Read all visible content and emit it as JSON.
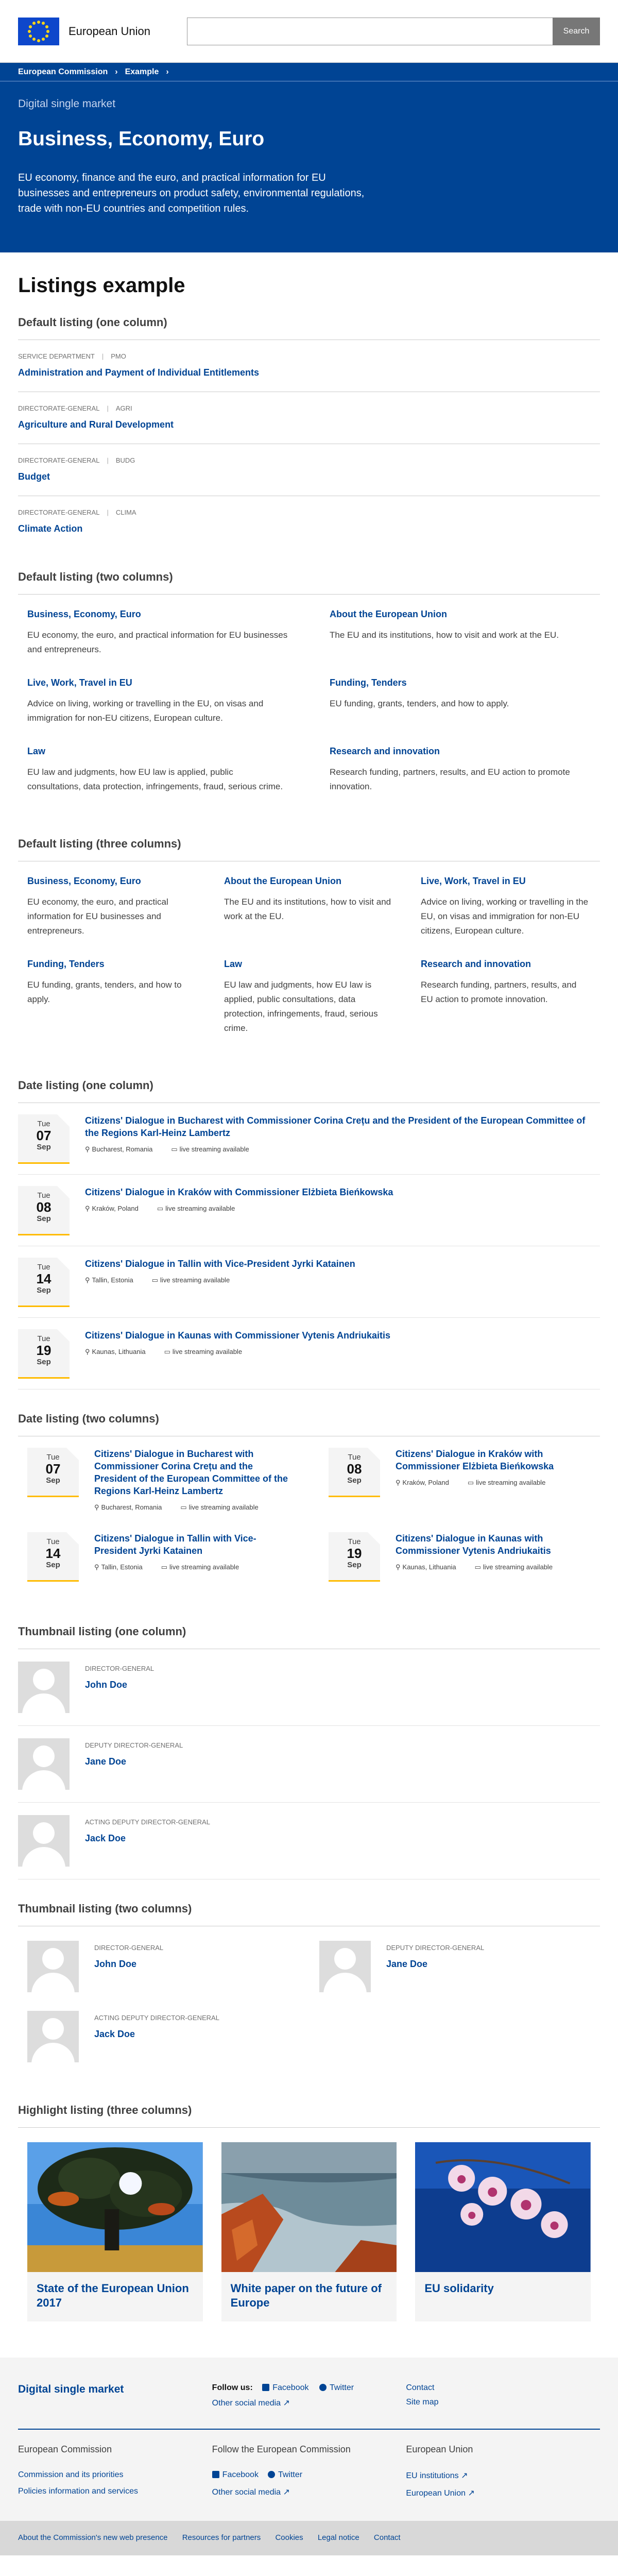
{
  "header": {
    "logo_text": "European Union",
    "search_placeholder": "",
    "search_button": "Search"
  },
  "breadcrumb": [
    "European Commission",
    "Example"
  ],
  "banner": {
    "site": "Digital single market",
    "title": "Business, Economy, Euro",
    "description": "EU economy, finance and the euro, and practical information for EU businesses and entrepreneurs on product safety, environmental regulations, trade with non-EU countries and competition rules."
  },
  "page_title": "Listings example",
  "list1": {
    "heading": "Default listing (one column)",
    "items": [
      {
        "meta1": "SERVICE DEPARTMENT",
        "meta2": "PMO",
        "title": "Administration and Payment of Individual Entitlements"
      },
      {
        "meta1": "DIRECTORATE-GENERAL",
        "meta2": "AGRI",
        "title": "Agriculture and Rural Development"
      },
      {
        "meta1": "DIRECTORATE-GENERAL",
        "meta2": "BUDG",
        "title": "Budget"
      },
      {
        "meta1": "DIRECTORATE-GENERAL",
        "meta2": "CLIMA",
        "title": "Climate Action"
      }
    ]
  },
  "list2": {
    "heading": "Default listing (two columns)",
    "items": [
      {
        "title": "Business, Economy, Euro",
        "text": "EU economy, the euro, and practical information for EU businesses and entrepreneurs."
      },
      {
        "title": "About the European Union",
        "text": "The EU and its institutions, how to visit and work at the EU."
      },
      {
        "title": "Live, Work, Travel in EU",
        "text": "Advice on living, working or travelling in the EU, on visas and immigration for non-EU citizens, European culture."
      },
      {
        "title": "Funding, Tenders",
        "text": "EU funding, grants, tenders, and how to apply."
      },
      {
        "title": "Law",
        "text": "EU law and judgments, how EU law is applied, public consultations, data protection, infringements, fraud, serious crime."
      },
      {
        "title": "Research and innovation",
        "text": "Research funding, partners, results, and EU action to promote innovation."
      }
    ]
  },
  "list3": {
    "heading": "Default listing (three columns)",
    "items": [
      {
        "title": "Business, Economy, Euro",
        "text": "EU economy, the euro, and practical information for EU businesses and entrepreneurs."
      },
      {
        "title": "About the European Union",
        "text": "The EU and its institutions, how to visit and work at the EU."
      },
      {
        "title": "Live, Work, Travel in EU",
        "text": "Advice on living, working or travelling in the EU, on visas and immigration for non-EU citizens, European culture."
      },
      {
        "title": "Funding, Tenders",
        "text": "EU funding, grants, tenders, and how to apply."
      },
      {
        "title": "Law",
        "text": "EU law and judgments, how EU law is applied, public consultations, data protection, infringements, fraud, serious crime."
      },
      {
        "title": "Research and innovation",
        "text": "Research funding, partners, results, and EU action to promote innovation."
      }
    ]
  },
  "dates1": {
    "heading": "Date listing (one column)"
  },
  "dates2": {
    "heading": "Date listing (two columns)"
  },
  "events": [
    {
      "day": "Tue",
      "date": "07",
      "month": "Sep",
      "title": "Citizens' Dialogue in Bucharest with Commissioner Corina Crețu and the President of the European Committee of the Regions Karl-Heinz Lambertz",
      "place": "Bucharest, Romania",
      "stream": "live streaming available"
    },
    {
      "day": "Tue",
      "date": "08",
      "month": "Sep",
      "title": "Citizens' Dialogue in Kraków with Commissioner Elżbieta Bieńkowska",
      "place": "Kraków, Poland",
      "stream": "live streaming available"
    },
    {
      "day": "Tue",
      "date": "14",
      "month": "Sep",
      "title": "Citizens' Dialogue in Tallin with Vice-President Jyrki Katainen",
      "place": "Tallin, Estonia",
      "stream": "live streaming available"
    },
    {
      "day": "Tue",
      "date": "19",
      "month": "Sep",
      "title": "Citizens' Dialogue in Kaunas with Commissioner Vytenis Andriukaitis",
      "place": "Kaunas, Lithuania",
      "stream": "live streaming available"
    }
  ],
  "thumbs1": {
    "heading": "Thumbnail listing (one column)"
  },
  "thumbs2": {
    "heading": "Thumbnail listing (two columns)"
  },
  "people": [
    {
      "role": "DIRECTOR-GENERAL",
      "name": "John Doe"
    },
    {
      "role": "DEPUTY DIRECTOR-GENERAL",
      "name": "Jane Doe"
    },
    {
      "role": "ACTING DEPUTY DIRECTOR-GENERAL",
      "name": "Jack Doe"
    }
  ],
  "highlight": {
    "heading": "Highlight listing (three columns)",
    "items": [
      {
        "title": "State of the European Union 2017"
      },
      {
        "title": "White paper on the future of Europe"
      },
      {
        "title": "EU solidarity"
      }
    ]
  },
  "footer1": {
    "site": "Digital single market",
    "follow": "Follow us:",
    "facebook": "Facebook",
    "twitter": "Twitter",
    "other": "Other social media",
    "contact": "Contact",
    "sitemap": "Site map"
  },
  "footer2": {
    "col1": {
      "title": "European Commission",
      "links": [
        "Commission and its priorities",
        "Policies information and services"
      ]
    },
    "col2": {
      "title": "Follow the European Commission",
      "facebook": "Facebook",
      "twitter": "Twitter",
      "other": "Other social media"
    },
    "col3": {
      "title": "European Union",
      "links": [
        "EU institutions",
        "European Union"
      ]
    }
  },
  "footer3": {
    "links": [
      "About the Commission's new web presence",
      "Resources for partners",
      "Cookies",
      "Legal notice",
      "Contact"
    ]
  },
  "colors": {
    "brand": "#004494",
    "accent": "#ffbb00"
  }
}
